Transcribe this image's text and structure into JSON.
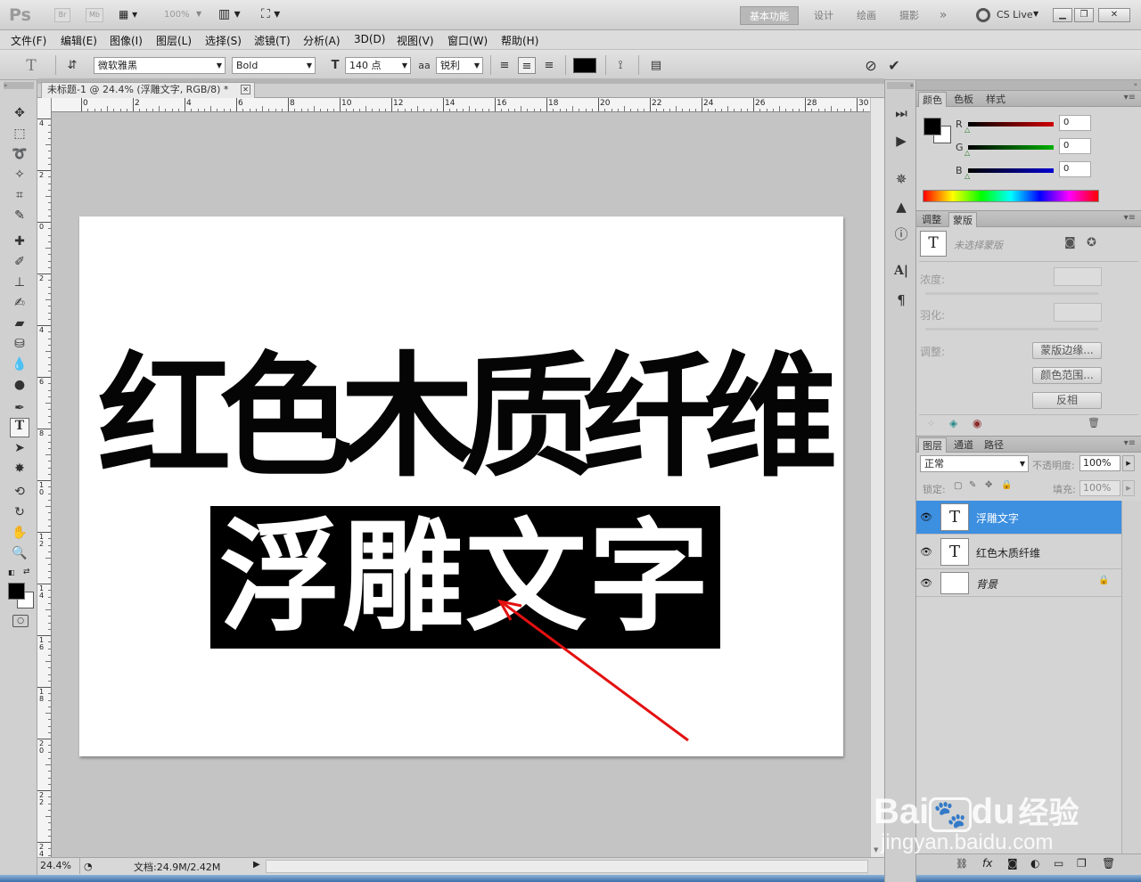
{
  "app": {
    "logo": "Ps",
    "bridge_label": "Br",
    "mini_bridge_label": "Mb",
    "zoom_display": "100%",
    "workspaces": [
      "基本功能",
      "设计",
      "绘画",
      "摄影"
    ],
    "workspace_more": "»",
    "cs_live": "CS Live"
  },
  "menu": [
    "文件(F)",
    "编辑(E)",
    "图像(I)",
    "图层(L)",
    "选择(S)",
    "滤镜(T)",
    "分析(A)",
    "3D(D)",
    "视图(V)",
    "窗口(W)",
    "帮助(H)"
  ],
  "options": {
    "tool_icon": "T",
    "font_family": "微软雅黑",
    "font_style": "Bold",
    "font_size": "140 点",
    "antialias_label": "aa",
    "antialias": "锐利",
    "color_swatch": "#000000"
  },
  "document": {
    "tab_title": "未标题-1 @ 24.4% (浮雕文字, RGB/8) *",
    "canvas_text_line1": "红色木质纤维",
    "canvas_text_line2": "浮雕文字",
    "ruler_top": [
      "0",
      "2",
      "4",
      "6",
      "8",
      "10",
      "12",
      "14",
      "16",
      "18",
      "20",
      "22",
      "24",
      "26",
      "28",
      "30"
    ],
    "ruler_left": [
      "4",
      "2",
      "0",
      "2",
      "4",
      "6",
      "8",
      "10",
      "12",
      "14",
      "16",
      "18",
      "20",
      "22",
      "24"
    ]
  },
  "status": {
    "zoom": "24.4%",
    "doc_size": "文档:24.9M/2.42M"
  },
  "color_panel": {
    "tabs": [
      "颜色",
      "色板",
      "样式"
    ],
    "channels": [
      {
        "label": "R",
        "value": "0",
        "color": "#d00000"
      },
      {
        "label": "G",
        "value": "0",
        "color": "#00b000"
      },
      {
        "label": "B",
        "value": "0",
        "color": "#0000d0"
      }
    ],
    "foreground": "#000000",
    "background": "#ffffff"
  },
  "mask_panel": {
    "tabs": [
      "调整",
      "蒙版"
    ],
    "no_mask": "未选择蒙版",
    "density_label": "浓度:",
    "feather_label": "羽化:",
    "refine_label": "调整:",
    "buttons": [
      "蒙版边缘...",
      "颜色范围...",
      "反相"
    ]
  },
  "layers_panel": {
    "tabs": [
      "图层",
      "通道",
      "路径"
    ],
    "blend_mode": "正常",
    "opacity_label": "不透明度:",
    "opacity": "100%",
    "lock_label": "锁定:",
    "fill_label": "填充:",
    "fill": "100%",
    "layers": [
      {
        "name": "浮雕文字",
        "thumb": "T",
        "selected": true
      },
      {
        "name": "红色木质纤维",
        "thumb": "T",
        "selected": false
      },
      {
        "name": "背景",
        "thumb": "",
        "selected": false
      }
    ]
  },
  "watermark": {
    "brand": "Bai",
    "brand2": "du",
    "product": "经验",
    "url": "jingyan.baidu.com"
  }
}
